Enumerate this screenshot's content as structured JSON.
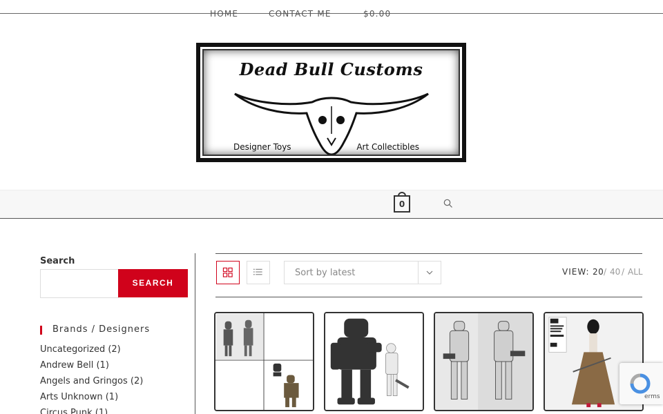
{
  "logo": {
    "title": "Dead Bull Customs",
    "tagline_left": "Designer Toys",
    "tagline_right": "Art Collectibles"
  },
  "nav": {
    "home": "HOME",
    "contact": "CONTACT ME",
    "cart_total": "$0.00",
    "cart_count": "0"
  },
  "sidebar": {
    "search_label": "Search",
    "search_placeholder": "",
    "search_button": "SEARCH",
    "brands_heading": "Brands / Designers",
    "brands": [
      "Uncategorized (2)",
      "Andrew Bell (1)",
      "Angels and Gringos (2)",
      "Arts Unknown (1)",
      "Circus Punk (1)"
    ]
  },
  "shop_toolbar": {
    "sort_selected": "Sort by latest",
    "view_label": "VIEW:",
    "view_options": [
      "20",
      "40",
      "ALL"
    ],
    "separator": "/"
  },
  "products": [
    {
      "icon": "figure-collage-image"
    },
    {
      "icon": "robot-and-figure-image"
    },
    {
      "icon": "soldier-figures-image"
    },
    {
      "icon": "kimono-figure-box-image"
    }
  ],
  "recaptcha": {
    "text": "erms"
  },
  "colors": {
    "accent": "#d0021b",
    "text": "#333333",
    "nav_bg": "#f7f7f7"
  }
}
